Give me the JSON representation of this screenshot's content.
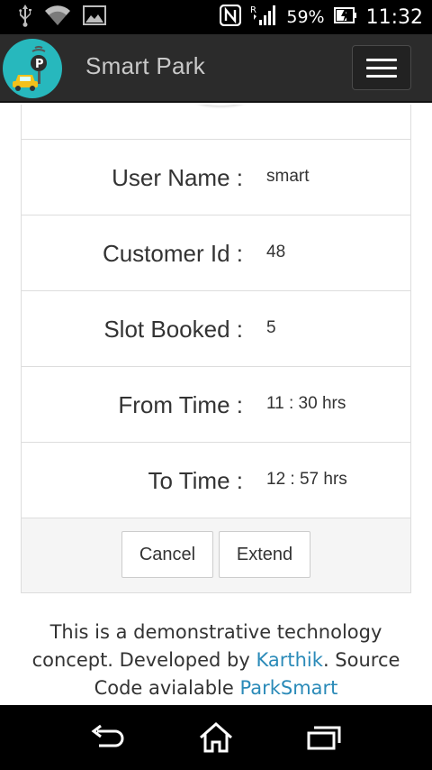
{
  "status_bar": {
    "icons": [
      "usb-icon",
      "wifi-icon",
      "image-icon",
      "nfc-icon",
      "signal-icon",
      "battery-charging-icon"
    ],
    "battery_pct": "59%",
    "time": "11:32"
  },
  "app_bar": {
    "title": "Smart Park",
    "logo_icon": "parking-car-logo",
    "menu_icon": "hamburger-menu-icon"
  },
  "details": [
    {
      "label": "User Name :",
      "value": "smart"
    },
    {
      "label": "Customer Id :",
      "value": "48"
    },
    {
      "label": "Slot Booked :",
      "value": "5"
    },
    {
      "label": "From Time :",
      "value": "11 : 30 hrs"
    },
    {
      "label": "To Time :",
      "value": "12 : 57 hrs"
    }
  ],
  "actions": {
    "cancel_label": "Cancel",
    "extend_label": "Extend"
  },
  "footer": {
    "text_1": "This is a demonstrative technology concept. Developed by ",
    "author_link": "Karthik",
    "text_2": ". Source Code avialable ",
    "repo_link": "ParkSmart"
  },
  "nav_bar": {
    "icons": [
      "back-icon",
      "home-icon",
      "recent-apps-icon"
    ]
  },
  "colors": {
    "app_bar": "#2b2b2b",
    "logo_bg": "#27b8bd",
    "link": "#2a8ab8",
    "actions_bg": "#f5f5f5"
  }
}
